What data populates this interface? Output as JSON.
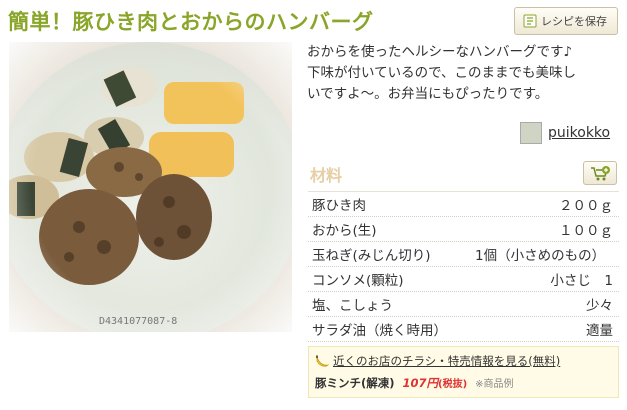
{
  "recipe": {
    "title": "簡単！豚ひき肉とおからのハンバーグ",
    "save_label": "レシピを保存",
    "description_lines": [
      "おからを使ったヘルシーなハンバーグです♪",
      "下味が付いているので、このままでも美味し",
      "いですよ〜。お弁当にもぴったりです。"
    ],
    "author": "puikokko",
    "photo_watermark": "D4341077087-8"
  },
  "ingredients": {
    "heading": "材料",
    "items": [
      {
        "name": "豚ひき肉",
        "qty": "２００ｇ"
      },
      {
        "name": "おから(生)",
        "qty": "１００ｇ"
      },
      {
        "name": "玉ねぎ(みじん切り)",
        "qty": "1個（小さめのもの）"
      },
      {
        "name": "コンソメ(顆粒)",
        "qty": "小さじ　1"
      },
      {
        "name": "塩、こしょう",
        "qty": "少々"
      },
      {
        "name": "サラダ油（焼く時用）",
        "qty": "適量"
      }
    ]
  },
  "promo": {
    "link": "近くのお店のチラシ・特売情報を見る(無料)",
    "product": "豚ミンチ(解凍)",
    "price": "107円",
    "tax": "(税抜)",
    "note": "※商品例"
  },
  "colors": {
    "title": "#8aa62a",
    "heading": "#e6cfa4",
    "price": "#d33333"
  },
  "icons": {
    "save": "recipe-book-icon",
    "cart": "cart-add-icon",
    "promo": "banana-icon"
  }
}
